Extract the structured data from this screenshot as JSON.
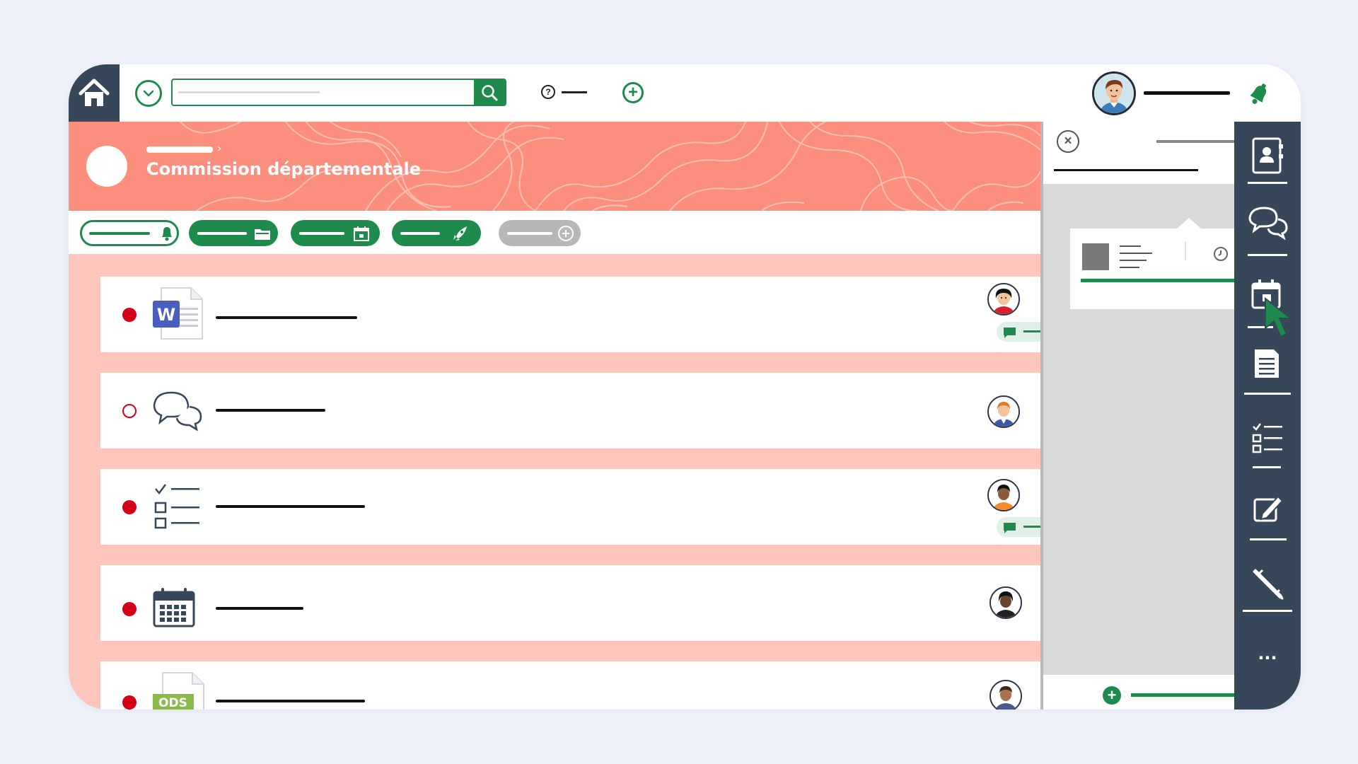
{
  "header": {
    "search_value": "",
    "search_placeholder": "",
    "help_symbol": "?",
    "add_symbol": "+"
  },
  "banner": {
    "title": "Commission départementale",
    "breadcrumb_arrow": "›"
  },
  "tabs": [
    {
      "name": "notifications",
      "style": "outline",
      "icon": "bell-icon"
    },
    {
      "name": "folder",
      "style": "solid",
      "icon": "folder-icon"
    },
    {
      "name": "calendar",
      "style": "solid",
      "icon": "calendar-icon"
    },
    {
      "name": "launch",
      "style": "solid",
      "icon": "rocket-icon"
    },
    {
      "name": "add",
      "style": "grey",
      "icon": "plus-circle-icon"
    }
  ],
  "items": [
    {
      "type": "word-document",
      "icon": "word-document-icon",
      "unread": true,
      "has_comment": true
    },
    {
      "type": "discussion",
      "icon": "chat-bubbles-icon",
      "unread": false,
      "has_comment": false
    },
    {
      "type": "task-list",
      "icon": "checklist-icon",
      "unread": true,
      "has_comment": true
    },
    {
      "type": "event",
      "icon": "calendar-icon",
      "unread": true,
      "has_comment": false
    },
    {
      "type": "spreadsheet",
      "icon": "ods-file-icon",
      "unread": true,
      "has_comment": false,
      "badge_text": "ODS"
    }
  ],
  "panel": {
    "close_symbol": "×",
    "add_symbol": "+"
  },
  "rail": {
    "items": [
      "contacts-icon",
      "chat-icon",
      "calendar-icon",
      "document-icon",
      "checklist-icon",
      "edit-icon",
      "pencil-icon"
    ],
    "more_label": "..."
  },
  "colors": {
    "accent_green": "#1e8a4c",
    "banner_salmon": "#fc8e7d",
    "list_background": "#fdc5bc",
    "rail_navy": "#37475a",
    "unread_red": "#d40016"
  }
}
